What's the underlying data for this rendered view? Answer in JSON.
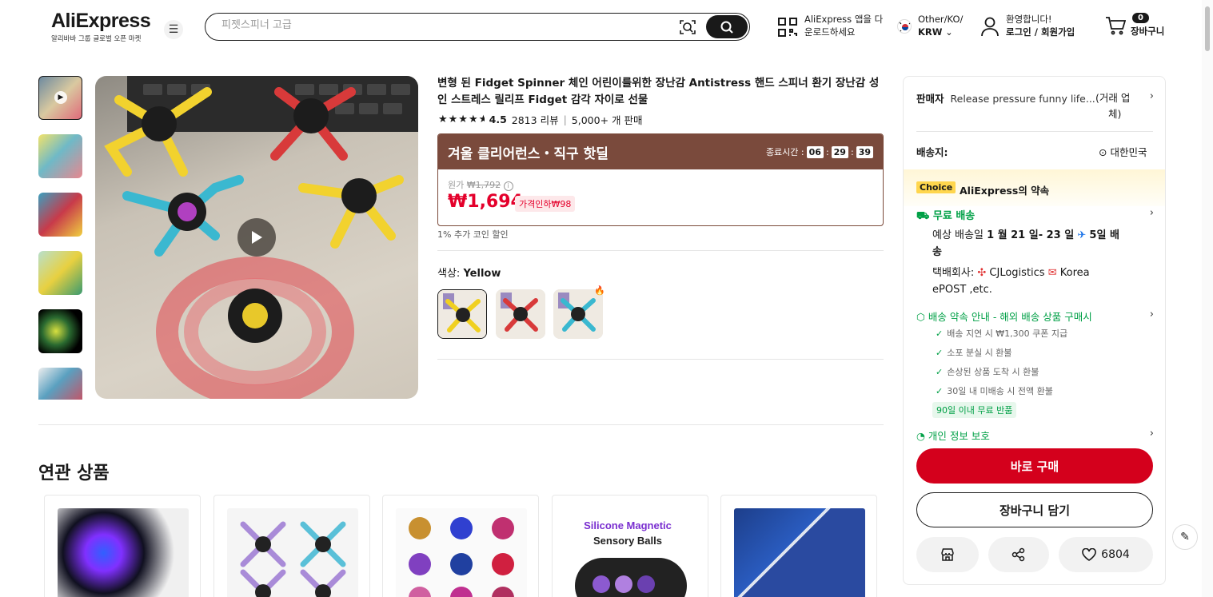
{
  "header": {
    "logo": "AliExpress",
    "logo_sub": "알리바바 그룹 글로벌 오픈 마켓",
    "search_placeholder": "피젯스피너 고급",
    "app_line1": "AliExpress 앱을 다",
    "app_line2": "운로드하세요",
    "region_line1": "Other/KO/",
    "region_line2": "KRW",
    "welcome": "환영합니다!",
    "login": "로그인 / 회원가입",
    "cart_count": "0",
    "cart_label": "장바구니"
  },
  "product": {
    "title": "변형 된 Fidget Spinner 체인 어린이를위한 장난감 Antistress 핸드 스피너 환기 장난감 성인 스트레스 릴리프 Fidget 감각 자이로 선물",
    "rating": "4.5",
    "stars": 4.5,
    "reviews": "2813 리뷰",
    "sold": "5,000+ 개 판매",
    "deal_title": "겨울 클리어런스・직구 핫딜",
    "timer_label": "종료시간 :",
    "timer_h": "06",
    "timer_m": "29",
    "timer_s": "39",
    "orig_label": "원가",
    "orig_price": "₩1,792",
    "price": "₩1,694",
    "discount": "가격인하₩98",
    "coin": "1% 추가 코인 할인",
    "color_label": "색상:",
    "color_value": "Yellow"
  },
  "related": {
    "title": "연관 상품",
    "card4_text1": "Silicone Magnetic",
    "card4_text2": "Sensory Balls"
  },
  "side": {
    "seller_label": "판매자",
    "seller_name": "Release pressure funny life...",
    "seller_type1": "(거래 업",
    "seller_type2": "체)",
    "ship_label": "배송지:",
    "ship_dest": "대한민국",
    "choice_tag": "Choice",
    "choice_promise": "AliExpress의 약속",
    "free_ship": "무료 배송",
    "est_line1_pre": "예상 배송일 ",
    "est_date": "1 월 21 일- 23 일",
    "est_days": "5일 배",
    "est_line2": "송",
    "courier_label": "택배회사:",
    "courier1": "CJLogistics",
    "courier2": "Korea",
    "courier3": "ePOST ,etc.",
    "guarantee": "배송 약속 안내 - 해외 배송 상품 구매시",
    "checks": [
      "배송 지연 시 ₩1,300 쿠폰 지급",
      "소포 분실 시 환불",
      "손상된 상품 도착 시 환불",
      "30일 내 미배송 시 전액 환불"
    ],
    "ninety": "90일 이내 무료 반품",
    "privacy": "개인 정보 보호",
    "buy": "바로 구매",
    "add_cart": "장바구니 담기",
    "wish_count": "6804"
  },
  "colors": {
    "accent": "#d4001c",
    "price": "#e4002b",
    "deal": "#7a4a3c",
    "green": "#00a046",
    "choice": "#ffd64d"
  }
}
